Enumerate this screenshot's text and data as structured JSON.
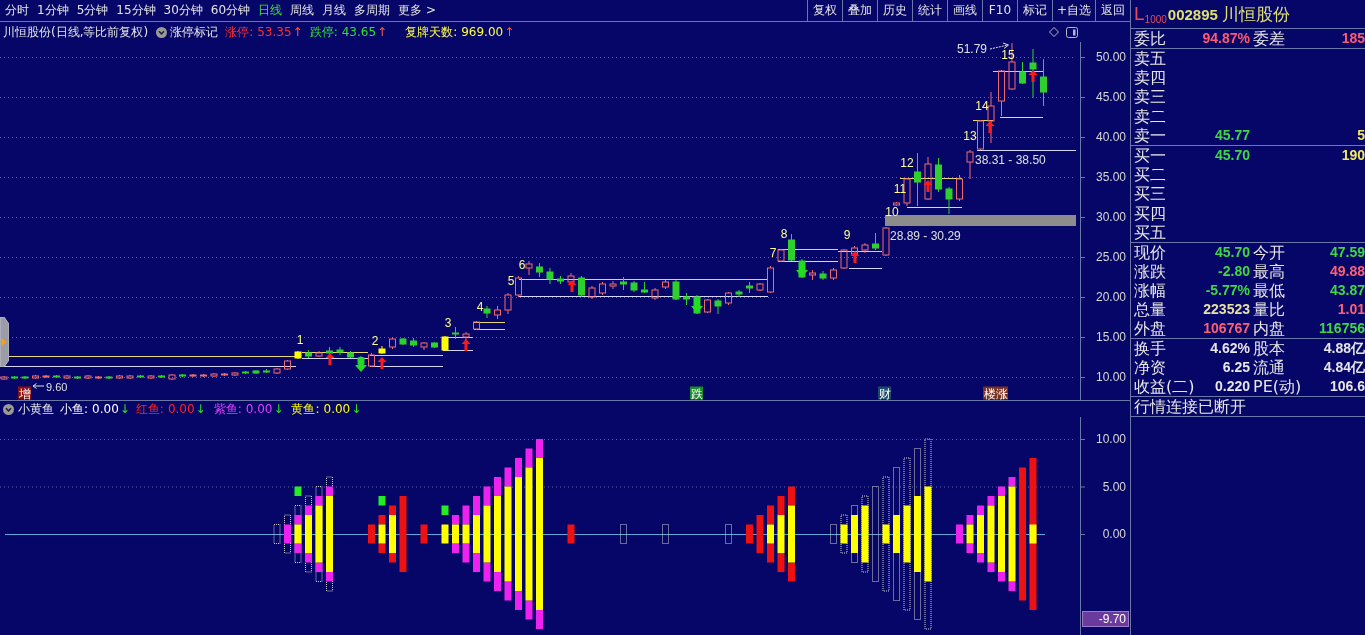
{
  "toolbar": {
    "periods": [
      {
        "label": "分时",
        "selected": false
      },
      {
        "label": "1分钟",
        "selected": false
      },
      {
        "label": "5分钟",
        "selected": false
      },
      {
        "label": "15分钟",
        "selected": false
      },
      {
        "label": "30分钟",
        "selected": false
      },
      {
        "label": "60分钟",
        "selected": false
      },
      {
        "label": "日线",
        "selected": true
      },
      {
        "label": "周线",
        "selected": false
      },
      {
        "label": "月线",
        "selected": false
      },
      {
        "label": "多周期",
        "selected": false
      },
      {
        "label": "更多 >",
        "selected": false
      }
    ],
    "actions": [
      "复权",
      "叠加",
      "历史",
      "统计",
      "画线",
      "F10",
      "标记",
      "+自选",
      "返回"
    ]
  },
  "main_chart": {
    "title": "川恒股份(日线,等比前复权)",
    "marker_menu": "涨停标记",
    "readings": [
      {
        "label": "涨停:",
        "value": "53.35",
        "arrow": "↑",
        "color": "#ff3030"
      },
      {
        "label": "跌停:",
        "value": "43.65",
        "arrow": "↑",
        "color": "#30e030"
      },
      {
        "label": "复牌天数:",
        "value": "969.00",
        "arrow": "↑",
        "color": "#ffff40"
      }
    ],
    "y_axis": [
      "50.00",
      "45.00",
      "40.00",
      "35.00",
      "30.00",
      "25.00",
      "20.00",
      "15.00",
      "10.00"
    ],
    "point_labels": [
      "1",
      "2",
      "3",
      "4",
      "5",
      "6",
      "7",
      "8",
      "9",
      "10",
      "11",
      "12",
      "13",
      "14",
      "15"
    ],
    "high_label": "51.79",
    "low_label": "9.60",
    "zone_labels": [
      "28.89 - 30.29",
      "38.31 - 38.50"
    ],
    "events": [
      {
        "text": "增",
        "color": "#8a1010"
      },
      {
        "text": "跌",
        "color": "#1a8a2a"
      },
      {
        "text": "财",
        "color": "#1a4a6a"
      },
      {
        "text": "楼涨",
        "color": "#7a3020"
      }
    ]
  },
  "indicator": {
    "name": "小黄鱼",
    "series": [
      {
        "label": "小鱼:",
        "value": "0.00",
        "arrow": "↓",
        "color": "#ffffff"
      },
      {
        "label": "红鱼:",
        "value": "0.00",
        "arrow": "↓",
        "color": "#ff2020"
      },
      {
        "label": "紫鱼:",
        "value": "0.00",
        "arrow": "↓",
        "color": "#e040ff"
      },
      {
        "label": "黄鱼:",
        "value": "0.00",
        "arrow": "↓",
        "color": "#ffff00"
      }
    ],
    "y_axis": [
      "10.00",
      "5.00",
      "0.00"
    ],
    "current_value": "-9.70"
  },
  "quote_panel": {
    "market_tag": "L$_{1000}$",
    "code": "002895",
    "name": "川恒股份",
    "ratio": [
      {
        "label": "委比",
        "value": "94.87%",
        "color": "#ff5a72"
      },
      {
        "label": "委差",
        "value": "185",
        "color": "#ff5a72"
      }
    ],
    "asks": [
      {
        "label": "卖五"
      },
      {
        "label": "卖四"
      },
      {
        "label": "卖三"
      },
      {
        "label": "卖二"
      },
      {
        "label": "卖一",
        "price": "45.77",
        "volume": "5"
      }
    ],
    "bids": [
      {
        "label": "买一",
        "price": "45.70",
        "volume": "190"
      },
      {
        "label": "买二"
      },
      {
        "label": "买三"
      },
      {
        "label": "买四"
      },
      {
        "label": "买五"
      }
    ],
    "quotes": [
      [
        {
          "label": "现价",
          "value": "45.70",
          "color": "#40d840"
        },
        {
          "label": "今开",
          "value": "47.59",
          "color": "#40d840"
        }
      ],
      [
        {
          "label": "涨跌",
          "value": "-2.80",
          "color": "#40d840"
        },
        {
          "label": "最高",
          "value": "49.88",
          "color": "#ff6070"
        }
      ],
      [
        {
          "label": "涨幅",
          "value": "-5.77%",
          "color": "#40d840"
        },
        {
          "label": "最低",
          "value": "43.87",
          "color": "#40d840"
        }
      ],
      [
        {
          "label": "总量",
          "value": "223523",
          "color": "#e8e0a0"
        },
        {
          "label": "量比",
          "value": "1.01",
          "color": "#ff6070"
        }
      ],
      [
        {
          "label": "外盘",
          "value": "106767",
          "color": "#ff6070"
        },
        {
          "label": "内盘",
          "value": "116756",
          "color": "#40d840"
        }
      ]
    ],
    "fundamentals": [
      [
        {
          "label": "换手",
          "value": "4.62%"
        },
        {
          "label": "股本",
          "value": "4.88亿"
        }
      ],
      [
        {
          "label": "净资",
          "value": "6.25"
        },
        {
          "label": "流通",
          "value": "4.84亿"
        }
      ],
      [
        {
          "label": "收益(二)",
          "value": "0.220"
        },
        {
          "label": "PE(动)",
          "value": "106.6"
        }
      ]
    ],
    "status": "行情连接已断开"
  }
}
